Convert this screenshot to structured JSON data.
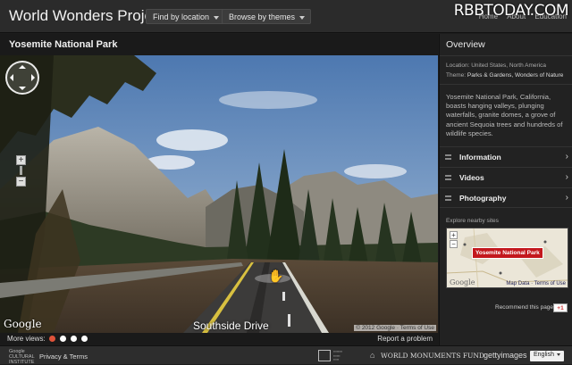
{
  "header": {
    "app_title": "World Wonders Project",
    "find_by_location": "Find by location",
    "browse_by_themes": "Browse by themes",
    "links": [
      "Home",
      "About",
      "Education"
    ],
    "watermark": "RBBTODAY.COM"
  },
  "site": {
    "title": "Yosemite National Park"
  },
  "viewer": {
    "google_logo": "Google",
    "street_label": "Southside Drive",
    "copyright": "© 2012 Google · Terms of Use",
    "more_views_label": "More views:",
    "views_count": 4,
    "active_view": 0,
    "report_label": "Report a problem"
  },
  "overview": {
    "title": "Overview",
    "location_label": "Location:",
    "location_value": "United States, North America",
    "theme_label": "Theme:",
    "theme_value": "Parks & Gardens, Wonders of Nature",
    "description": "Yosemite National Park, California, boasts hanging valleys, plunging waterfalls, granite domes, a grove of ancient Sequoia trees and hundreds of wildlife species.",
    "sections": [
      {
        "label": "Information",
        "icon": "list-icon"
      },
      {
        "label": "Videos",
        "icon": "video-icon"
      },
      {
        "label": "Photography",
        "icon": "camera-icon"
      }
    ],
    "nearby_label": "Explore nearby sites",
    "map_pin_label": "Yosemite National Park",
    "map_google": "Google",
    "map_links": "Map Data · Terms of Use",
    "recommend": "Recommend this page",
    "gplus": "+1"
  },
  "footer": {
    "gci_line1": "Google",
    "gci_line2": "CULTURAL",
    "gci_line3": "INSTITUTE",
    "privacy": "Privacy & Terms",
    "wmf": "WORLD MONUMENTS FUND",
    "getty": "gettyimages",
    "language": "English"
  },
  "colors": {
    "accent_red": "#c3181d",
    "active_dot": "#e0533a"
  }
}
